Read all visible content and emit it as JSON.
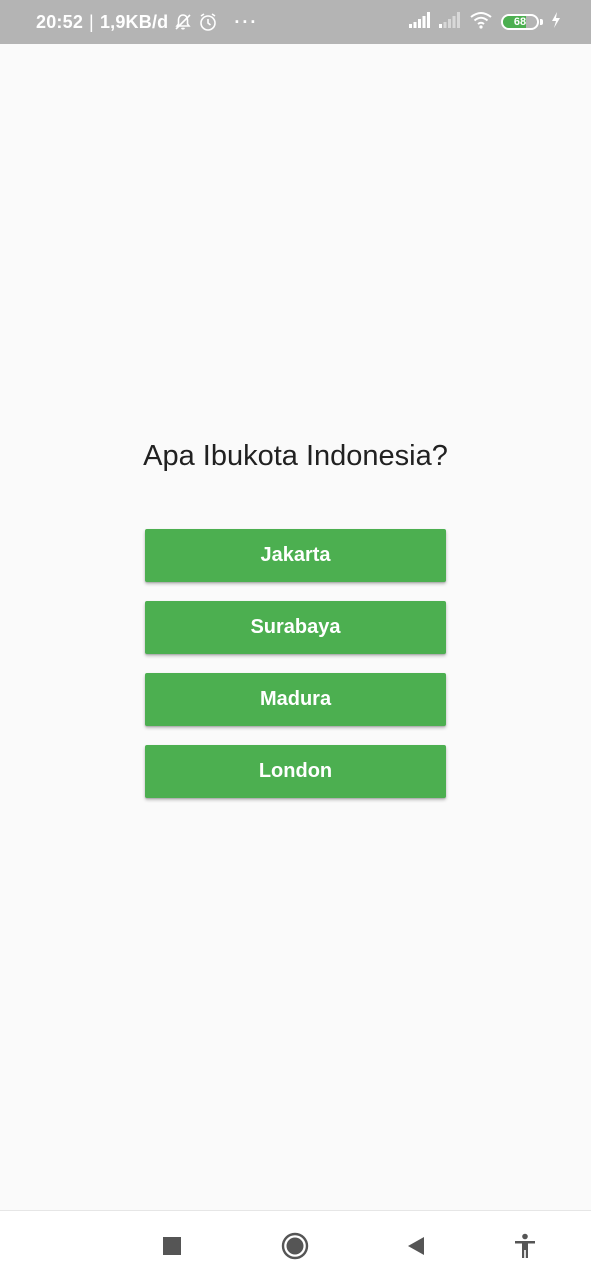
{
  "status_bar": {
    "time": "20:52",
    "separator": "|",
    "network_speed": "1,9KB/d",
    "more": "···",
    "battery_level": 68,
    "battery_text": "68",
    "icons": [
      "bell-off-icon",
      "alarm-icon",
      "signal-icon",
      "signal-icon",
      "wifi-icon",
      "battery-icon",
      "charging-icon"
    ]
  },
  "quiz": {
    "question": "Apa Ibukota Indonesia?",
    "answers": [
      "Jakarta",
      "Surabaya",
      "Madura",
      "London"
    ]
  },
  "colors": {
    "status_bar": "#b4b4b4",
    "background": "#fafafa",
    "button": "#4caf50",
    "button_text": "#ffffff",
    "question_text": "#212121"
  },
  "nav_bar": {
    "icons": [
      "recents-icon",
      "home-icon",
      "back-icon",
      "accessibility-icon"
    ]
  }
}
